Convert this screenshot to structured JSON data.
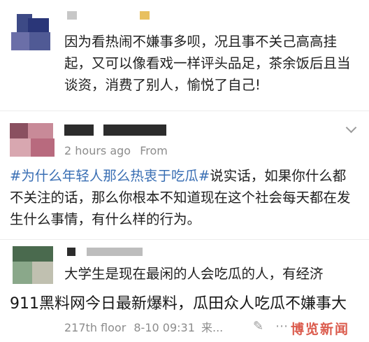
{
  "post1": {
    "body": "因为看热闹不嫌事多呗，况且事不关己高高挂起，又可以像看戏一样评头品足，茶余饭后且当谈资，消费了别人，愉悦了自己!"
  },
  "post2": {
    "time": "2 hours ago",
    "source": "From",
    "hashtag": "#为什么年轻人那么热衷于吃瓜#",
    "body": "说实话，如果你什么都不关注的话，那么你根本不知道现在这个社会每天都在发生什么事情，有什么样的行为。"
  },
  "post3": {
    "body": "大学生是现在最闲的人会吃瓜的人，有经济",
    "floor": "217th floor",
    "time": "8-10 09:31",
    "suffix": "来..."
  },
  "caption": "911黑料网今日最新爆料，瓜田众人吃瓜不嫌事大",
  "watermark": "博览新闻",
  "icons": {
    "collapse": "chevron-down-icon",
    "edit": "edit-icon",
    "more": "more-icon"
  }
}
